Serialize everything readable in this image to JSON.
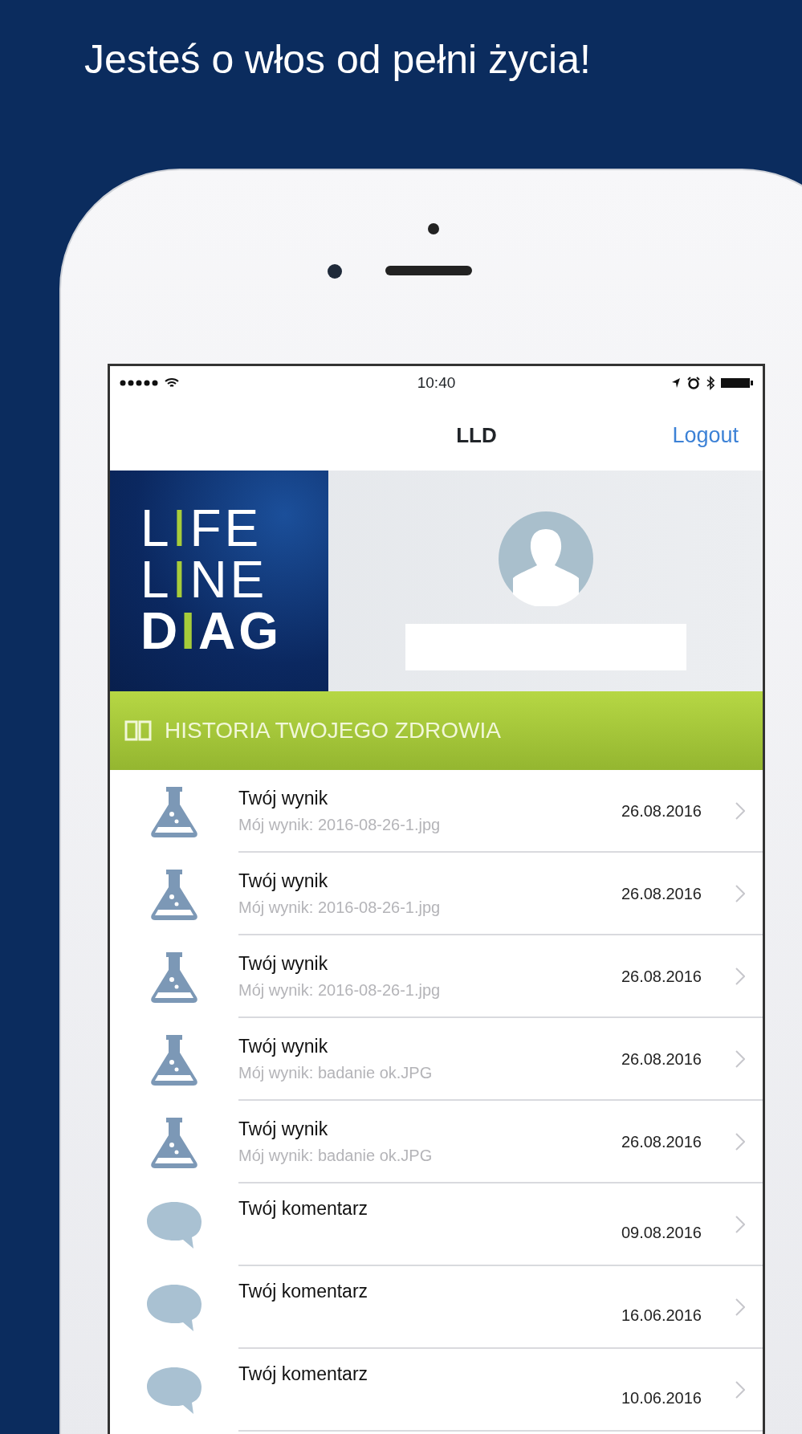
{
  "headline": "Jesteś o włos od pełni życia!",
  "status_bar": {
    "time": "10:40"
  },
  "nav_bar": {
    "title": "LLD",
    "action": "Logout"
  },
  "logo": {
    "lines": [
      "LIFE",
      "LINE",
      "DIAG"
    ]
  },
  "section": {
    "title": "HISTORIA TWOJEGO ZDROWIA"
  },
  "rows": [
    {
      "kind": "result",
      "title": "Twój wynik",
      "subtitle": "Mój wynik: 2016-08-26-1.jpg",
      "date": "26.08.2016"
    },
    {
      "kind": "result",
      "title": "Twój wynik",
      "subtitle": "Mój wynik: 2016-08-26-1.jpg",
      "date": "26.08.2016"
    },
    {
      "kind": "result",
      "title": "Twój wynik",
      "subtitle": "Mój wynik: 2016-08-26-1.jpg",
      "date": "26.08.2016"
    },
    {
      "kind": "result",
      "title": "Twój wynik",
      "subtitle": "Mój wynik: badanie ok.JPG",
      "date": "26.08.2016"
    },
    {
      "kind": "result",
      "title": "Twój wynik",
      "subtitle": "Mój wynik: badanie ok.JPG",
      "date": "26.08.2016"
    },
    {
      "kind": "comment",
      "title": "Twój komentarz",
      "date": "09.08.2016"
    },
    {
      "kind": "comment",
      "title": "Twój komentarz",
      "date": "16.06.2016"
    },
    {
      "kind": "comment",
      "title": "Twój komentarz",
      "date": "10.06.2016"
    }
  ]
}
